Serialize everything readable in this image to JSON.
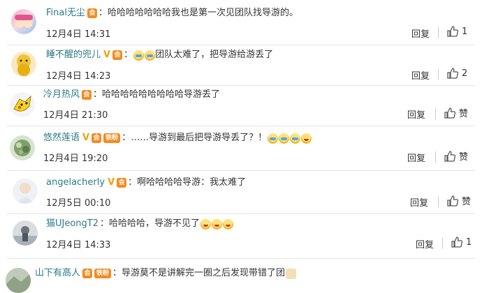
{
  "colors": {
    "username": "#2c7a88",
    "badge": "#f58b1f",
    "text": "#333333"
  },
  "comments": [
    {
      "username": "Final无尘",
      "badges": [
        "vip"
      ],
      "text": "哈哈哈哈哈哈哈我也是第一次见团队找导游的。",
      "emojis": [],
      "time": "12月4日 14:31",
      "reply": "回复",
      "likes": "1"
    },
    {
      "username": "睡不醒的兜儿",
      "badges": [
        "v",
        "vip"
      ],
      "text": "团队太难了，把导游给游丢了",
      "emojis_before": [
        "cry",
        "cry"
      ],
      "time": "12月4日 14:23",
      "reply": "回复",
      "likes": "2"
    },
    {
      "username": "冷月热风",
      "badges": [
        "vip"
      ],
      "text": "哈哈哈哈哈哈哈哈哈导游丢了",
      "emojis": [],
      "time": "12月4日 21:30",
      "reply": "回复",
      "likes": "赞"
    },
    {
      "username": "悠然莲语",
      "badges": [
        "v",
        "fan"
      ],
      "fan_label": "铁粉",
      "text": "……导游到最后把导游导丢了？！",
      "emojis": [
        "cry",
        "cry",
        "cry",
        "laugh"
      ],
      "time": "12月4日 19:20",
      "reply": "回复",
      "likes": "赞"
    },
    {
      "username": "angelacherly",
      "badges": [
        "v",
        "vip"
      ],
      "text": "啊哈哈哈哈导游：我太难了",
      "emojis": [],
      "time": "12月5日 00:10",
      "reply": "回复",
      "likes": "赞"
    },
    {
      "username": "猫UJeongT2",
      "badges": [],
      "text": "哈哈哈哈，导游不见了",
      "emojis": [
        "laugh",
        "laugh",
        "laugh"
      ],
      "time": "12月4日 14:33",
      "reply": "回复",
      "likes": "1"
    },
    {
      "username": "山下有高人",
      "badges": [
        "vip",
        "fan"
      ],
      "fan_label": "铁粉",
      "text": "导游莫不是讲解完一圈之后发现带错了团",
      "emojis": [
        "dog"
      ],
      "time": "",
      "reply": "",
      "likes": ""
    }
  ]
}
